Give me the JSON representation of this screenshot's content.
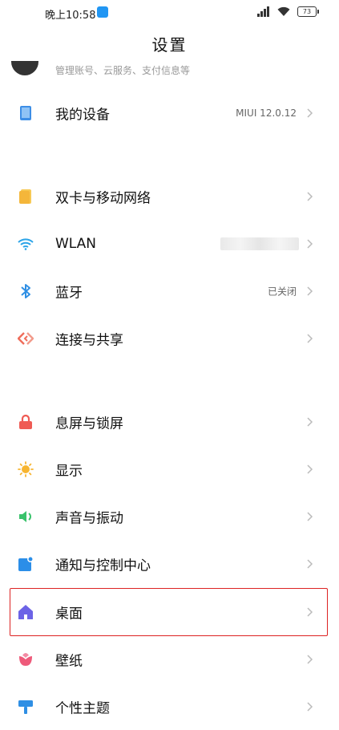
{
  "status_bar": {
    "time": "晚上10:58",
    "battery": "73"
  },
  "header": {
    "title": "设置"
  },
  "account": {
    "subtitle": "管理账号、云服务、支付信息等"
  },
  "items": [
    {
      "key": "my-device",
      "label": "我的设备",
      "value": "MIUI 12.0.12",
      "icon": "device-icon",
      "color": "#3d8ee6"
    },
    {
      "key": "dual-sim",
      "label": "双卡与移动网络",
      "value": "",
      "icon": "sim-card-icon",
      "color": "#f4b63a"
    },
    {
      "key": "wlan",
      "label": "WLAN",
      "value": "",
      "icon": "wifi-icon",
      "color": "#2ba4e8"
    },
    {
      "key": "bluetooth",
      "label": "蓝牙",
      "value": "已关闭",
      "icon": "bluetooth-icon",
      "color": "#2f8fe4"
    },
    {
      "key": "connection-sharing",
      "label": "连接与共享",
      "value": "",
      "icon": "share-icon",
      "color": "#ef6d5b"
    },
    {
      "key": "lock-screen",
      "label": "息屏与锁屏",
      "value": "",
      "icon": "lock-icon",
      "color": "#ef5b54"
    },
    {
      "key": "display",
      "label": "显示",
      "value": "",
      "icon": "sun-icon",
      "color": "#f7b531"
    },
    {
      "key": "sound",
      "label": "声音与振动",
      "value": "",
      "icon": "speaker-icon",
      "color": "#39c26b"
    },
    {
      "key": "notifications",
      "label": "通知与控制中心",
      "value": "",
      "icon": "notification-icon",
      "color": "#2b8ee8"
    },
    {
      "key": "home-screen",
      "label": "桌面",
      "value": "",
      "icon": "home-icon",
      "color": "#6c63e6"
    },
    {
      "key": "wallpaper",
      "label": "壁纸",
      "value": "",
      "icon": "flower-icon",
      "color": "#ee5a7a"
    },
    {
      "key": "themes",
      "label": "个性主题",
      "value": "",
      "icon": "brush-icon",
      "color": "#2f8fe4"
    }
  ]
}
